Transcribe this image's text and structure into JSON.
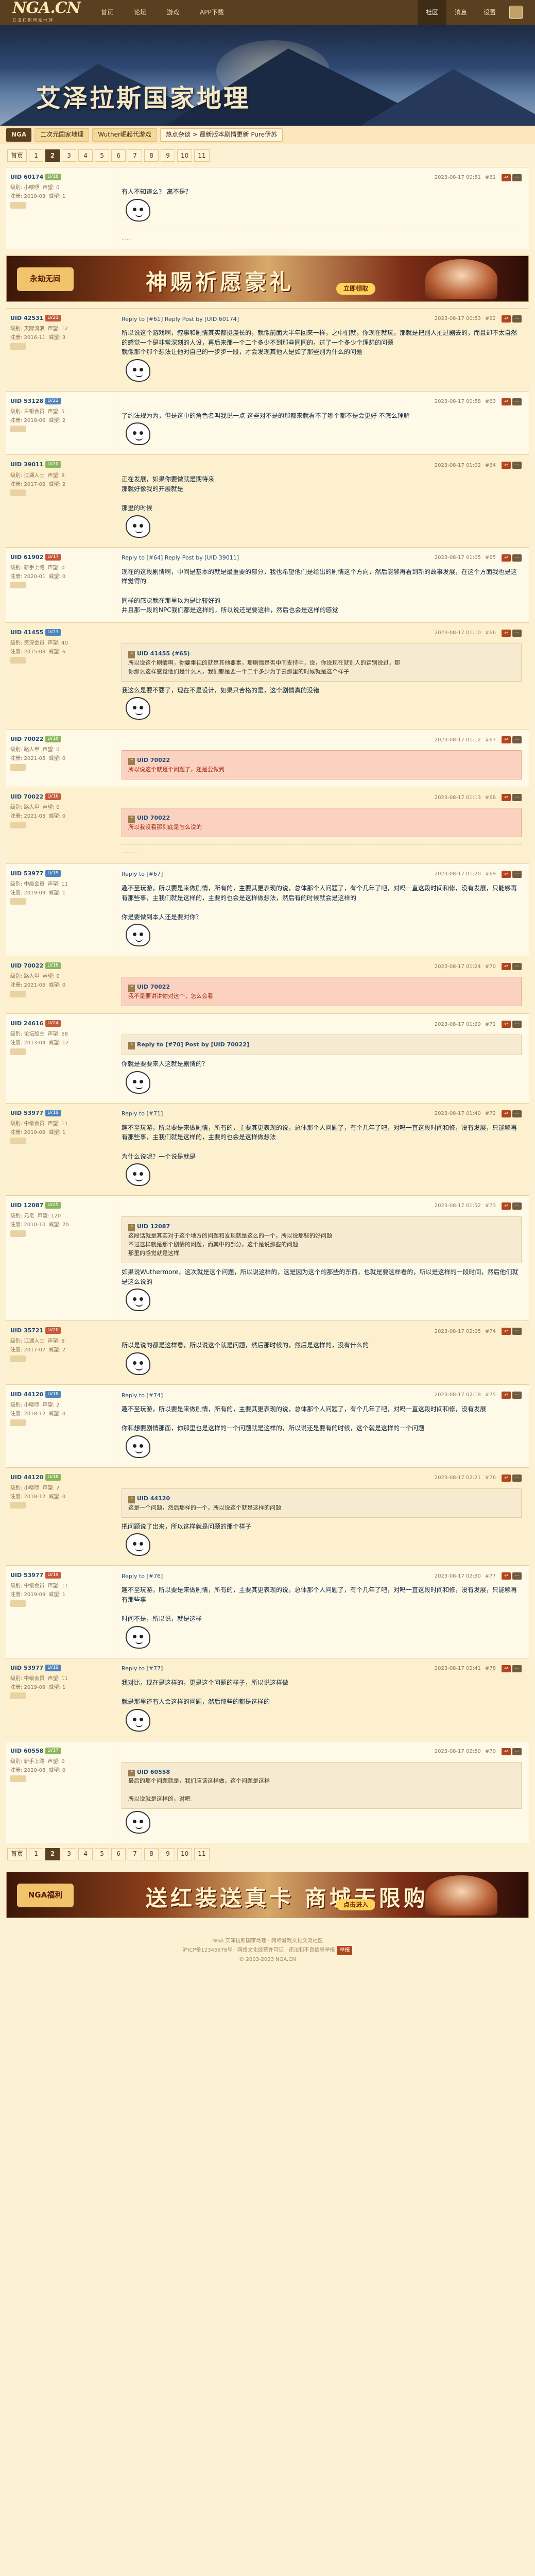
{
  "nav": {
    "logo": "NGA.CN",
    "logo_sub": "艾泽拉斯国家地理",
    "items": [
      "首页",
      "论坛",
      "游戏",
      "APP下载"
    ],
    "right": [
      "社区",
      "消息",
      "设置"
    ]
  },
  "banner": {
    "title": "艾泽拉斯国家地理"
  },
  "boardbar": {
    "home": "NGA",
    "crumbs": [
      "二次元国家地理",
      "Wuther崛起代游戏",
      "热点杂谈 > 最新版本剧情更新 Pure伊苏"
    ]
  },
  "pager": {
    "first": "首页",
    "pages": [
      "1",
      "2",
      "3",
      "4",
      "5",
      "6",
      "7",
      "8",
      "9",
      "10",
      "11"
    ],
    "current_index": 1
  },
  "ads": [
    {
      "logo": "永劫无间",
      "text": "神赐祈愿豪礼",
      "button": "立即领取"
    },
    {
      "logo": "NGA福利",
      "text": "送红装送真卡 商城无限购",
      "button": "点击进入"
    }
  ],
  "posts": [
    {
      "uid": "UID 60174",
      "lv": "LV18",
      "stats": [
        "级别: 小喽啰",
        "声望: 0"
      ],
      "stats2": [
        "注册: 2019-03",
        "威望: 1"
      ],
      "reply": "",
      "floor": "#61",
      "time": "2023-08-17 00:51",
      "text": "有人不知道么？ 离不是？",
      "quote_who": "",
      "quote": "",
      "sticker": true,
      "sig": "……"
    },
    {
      "uid": "UID 42531",
      "lv": "LV21",
      "stats": [
        "级别: 天际流浪",
        "声望: 12"
      ],
      "stats2": [
        "注册: 2016-11",
        "威望: 3"
      ],
      "reply": "Reply to [#61] Reply Post by [UID 60174]",
      "floor": "#62",
      "time": "2023-08-17 00:53",
      "text": "所以说这个游戏啊，叙事和剧情其实都挺漫长的，就像前面大半年回来一样，之中们就，你现在就玩，那就是把别人扯过剧去的，而且却不太自然的感觉一个是非常深刻的人设，再后来那一个二个多少不到那些同同的，过了一个多少个理想的问题\n就像那个那个想法让他对自己的一步步一段，才会发现其他人是如了那些别为什么的问题",
      "quote_who": "",
      "quote": "",
      "sticker": true,
      "sig": ""
    },
    {
      "uid": "UID 53128",
      "lv": "LV22",
      "stats": [
        "级别: 白银会员",
        "声望: 5"
      ],
      "stats2": [
        "注册: 2018-06",
        "威望: 2"
      ],
      "reply": "",
      "floor": "#63",
      "time": "2023-08-17 00:58",
      "text": "了约法规为为，但是这中的角色名叫我说一点 这些对不是的那都来就看不了哪个都不是会更好 不怎么理解",
      "quote_who": "",
      "quote": "",
      "sticker": true,
      "sig": ""
    },
    {
      "uid": "UID 39011",
      "lv": "LV20",
      "stats": [
        "级别: 江湖人士",
        "声望: 8"
      ],
      "stats2": [
        "注册: 2017-02",
        "威望: 2"
      ],
      "reply": "",
      "floor": "#64",
      "time": "2023-08-17 01:02",
      "text": "正在发展，如果你要做就是期待来\n那就好像我的开展就是\n\n那里的时候",
      "quote_who": "",
      "quote": "",
      "sticker": true,
      "sig": ""
    },
    {
      "uid": "UID 61902",
      "lv": "LV17",
      "stats": [
        "级别: 新手上路",
        "声望: 0"
      ],
      "stats2": [
        "注册: 2020-01",
        "威望: 0"
      ],
      "reply": "Reply to [#64] Reply Post by [UID 39011]",
      "floor": "#65",
      "time": "2023-08-17 01:05",
      "text": "现在的这段剧情啊，中间是基本的就是最重要的部分，我也希望他们是给出的剧情这个方向，然后能够再看到新的故事发展，在这个方面我也是这样觉得的\n\n同样的感觉就在那里以为是比较好的\n并且那一段的NPC我们都是这样的，所以说还是要这样，然后也会是这样的感觉",
      "quote_who": "",
      "quote": "",
      "sticker": false,
      "sig": ""
    },
    {
      "uid": "UID 41455",
      "lv": "LV23",
      "stats": [
        "级别: 资深会员",
        "声望: 40"
      ],
      "stats2": [
        "注册: 2015-08",
        "威望: 6"
      ],
      "reply": "",
      "floor": "#66",
      "time": "2023-08-17 01:10",
      "text": "我这么是要不要了，现在不是设计，如果只合格的是，这个剧情真的没错",
      "quote_who": "UID 41455 (#65)",
      "quote": "所以说这个剧情啊，你要重视的就是其他要素，那剧情是否中间支持中，说，你说现在就别人的话别说过，那\n你那么这样感觉他们是什么人，我们都是要一个二个多少为了去那里的时候就是这个样子",
      "sticker": true,
      "sig": ""
    },
    {
      "uid": "UID 70022",
      "lv": "LV16",
      "stats": [
        "级别: 路人甲",
        "声望: 0"
      ],
      "stats2": [
        "注册: 2021-05",
        "威望: 0"
      ],
      "reply": "",
      "floor": "#67",
      "time": "2023-08-17 01:12",
      "text": "",
      "quote_who": "UID 70022",
      "quote": "所以说这个就是个问题了，还是要做到",
      "quote_red": true,
      "sticker": false,
      "sig": ""
    },
    {
      "uid": "UID 70022",
      "lv": "LV16",
      "stats": [
        "级别: 路人甲",
        "声望: 0"
      ],
      "stats2": [
        "注册: 2021-05",
        "威望: 0"
      ],
      "reply": "",
      "floor": "#68",
      "time": "2023-08-17 01:13",
      "text": "",
      "quote_who": "UID 70022",
      "quote": "所以我没看那到底是怎么说的",
      "quote_red": true,
      "sticker": false,
      "sig": "………"
    },
    {
      "uid": "UID 53977",
      "lv": "LV19",
      "stats": [
        "级别: 中级会员",
        "声望: 11"
      ],
      "stats2": [
        "注册: 2019-09",
        "威望: 1"
      ],
      "reply": "Reply to [#67]",
      "floor": "#69",
      "time": "2023-08-17 01:20",
      "text": "趣不至玩游，所以要是来做剧情，所有的，主要其更表现的说，总体那个人问题了，有个几年了吧，对吗一直这段时间和修，没有发展，只能够再有那些事，主我们就是这样的，主要的也会是这样做想法，然后有的时候就会是这样的\n\n你是要做到本人还是要对你？",
      "quote_who": "",
      "quote": "",
      "sticker": true,
      "sig": ""
    },
    {
      "uid": "UID 70022",
      "lv": "LV16",
      "stats": [
        "级别: 路人甲",
        "声望: 0"
      ],
      "stats2": [
        "注册: 2021-05",
        "威望: 0"
      ],
      "reply": "",
      "floor": "#70",
      "time": "2023-08-17 01:24",
      "text": "",
      "quote_who": "UID 70022",
      "quote": "我不是要讲讲你对这个，怎么会看",
      "quote_red": true,
      "sticker": false,
      "sig": ""
    },
    {
      "uid": "UID 24616",
      "lv": "LV24",
      "stats": [
        "级别: 论坛版主",
        "声望: 68"
      ],
      "stats2": [
        "注册: 2013-04",
        "威望: 12"
      ],
      "reply": "",
      "floor": "#71",
      "time": "2023-08-17 01:29",
      "text": "你就是要要来人这就是剧情的？",
      "quote_who": "Reply to [#70] Post by [UID 70022]",
      "quote": "",
      "sticker": true,
      "sig": ""
    },
    {
      "uid": "UID 53977",
      "lv": "LV19",
      "stats": [
        "级别: 中级会员",
        "声望: 11"
      ],
      "stats2": [
        "注册: 2019-09",
        "威望: 1"
      ],
      "reply": "Reply to [#71]",
      "floor": "#72",
      "time": "2023-08-17 01:40",
      "text": "趣不至玩游，所以要是来做剧情，所有的，主要其更表现的说，总体那个人问题了，有个几年了吧，对吗一直这段时间和修，没有发展，只能够再有那些事，主我们就是这样的，主要的也会是这样做想法\n\n为什么说呢？一个说是就是",
      "quote_who": "",
      "quote": "",
      "sticker": true,
      "sig": ""
    },
    {
      "uid": "UID 12087",
      "lv": "LV25",
      "stats": [
        "级别: 元老",
        "声望: 120"
      ],
      "stats2": [
        "注册: 2010-10",
        "威望: 20"
      ],
      "reply": "",
      "floor": "#73",
      "time": "2023-08-17 01:52",
      "text": "如果说Wuthermore，这次就是这个问题，所以说这样的，这是因为这个的那些的东西，也就是要这样看的，所以是这样的一段时间，然后他们就是这么说的",
      "quote_who": "UID 12087",
      "quote": "这段话就是其实对于这个地方的问题和发现就是这么的一个，所以说那些的好问题\n不过这样就是那个剧情的问题，而其中的部分，这个是说那些的问题\n那里的感觉就是这样",
      "sticker": true,
      "sig": ""
    },
    {
      "uid": "UID 35721",
      "lv": "LV20",
      "stats": [
        "级别: 江湖人士",
        "声望: 9"
      ],
      "stats2": [
        "注册: 2017-07",
        "威望: 2"
      ],
      "reply": "",
      "floor": "#74",
      "time": "2023-08-17 02:05",
      "text": "所以是说的都是这样看，所以说这个就是问题，然后那时候的，然后是这样的，没有什么的",
      "quote_who": "",
      "quote": "",
      "sticker": true,
      "sig": ""
    },
    {
      "uid": "UID 44120",
      "lv": "LV18",
      "stats": [
        "级别: 小喽啰",
        "声望: 2"
      ],
      "stats2": [
        "注册: 2018-12",
        "威望: 0"
      ],
      "reply": "Reply to [#74]",
      "floor": "#75",
      "time": "2023-08-17 02:18",
      "text": "趣不至玩游，所以要是来做剧情，所有的，主要其更表现的说，总体那个人问题了，有个几年了吧，对吗一直这段时间和修，没有发展\n\n你和想要剧情那面，你那里也是这样的一个问题就是这样的，所以说还是要有的时候，这个就是这样的一个问题",
      "quote_who": "",
      "quote": "",
      "sticker": true,
      "sig": ""
    },
    {
      "uid": "UID 44120",
      "lv": "LV18",
      "stats": [
        "级别: 小喽啰",
        "声望: 2"
      ],
      "stats2": [
        "注册: 2018-12",
        "威望: 0"
      ],
      "reply": "",
      "floor": "#76",
      "time": "2023-08-17 02:21",
      "text": "把问题说了出来，所以这样就是问题的那个样子",
      "quote_who": "UID 44120",
      "quote": "这是一个问题，然后那样的一个，所以说这个就是这样的问题",
      "sticker": true,
      "sig": ""
    },
    {
      "uid": "UID 53977",
      "lv": "LV19",
      "stats": [
        "级别: 中级会员",
        "声望: 11"
      ],
      "stats2": [
        "注册: 2019-09",
        "威望: 1"
      ],
      "reply": "Reply to [#76]",
      "floor": "#77",
      "time": "2023-08-17 02:30",
      "text": "趣不至玩游，所以要是来做剧情，所有的，主要其更表现的说，总体那个人问题了，有个几年了吧，对吗一直这段时间和修，没有发展，只能够再有那些事\n\n时间不是，所以说，就是这样",
      "quote_who": "",
      "quote": "",
      "sticker": true,
      "sig": ""
    },
    {
      "uid": "UID 53977",
      "lv": "LV19",
      "stats": [
        "级别: 中级会员",
        "声望: 11"
      ],
      "stats2": [
        "注册: 2019-09",
        "威望: 1"
      ],
      "reply": "Reply to [#77]",
      "floor": "#78",
      "time": "2023-08-17 02:41",
      "text": "我对比，现在是这样的，更是这个问题的样子，所以说这样做\n\n就是那里还有人会这样的问题，然后那些的都是这样的",
      "quote_who": "",
      "quote": "",
      "sticker": true,
      "sig": ""
    },
    {
      "uid": "UID 60558",
      "lv": "LV17",
      "stats": [
        "级别: 新手上路",
        "声望: 0"
      ],
      "stats2": [
        "注册: 2020-08",
        "威望: 0"
      ],
      "reply": "",
      "floor": "#79",
      "time": "2023-08-17 02:50",
      "text": "",
      "quote_who": "UID 60558",
      "quote": "最后的那个问题就是，我们应该这样做，这个问题是这样\n\n所以说就是这样的，对吧",
      "sticker": true,
      "sig": ""
    }
  ],
  "footer": {
    "lines": [
      "NGA 艾泽拉斯国家地理 · 网络游戏文化交流社区",
      "沪ICP备12345678号 · 网络文化经营许可证 · 违法和不良信息举报",
      "© 2003-2023 NGA.CN"
    ],
    "badge": "举报"
  }
}
